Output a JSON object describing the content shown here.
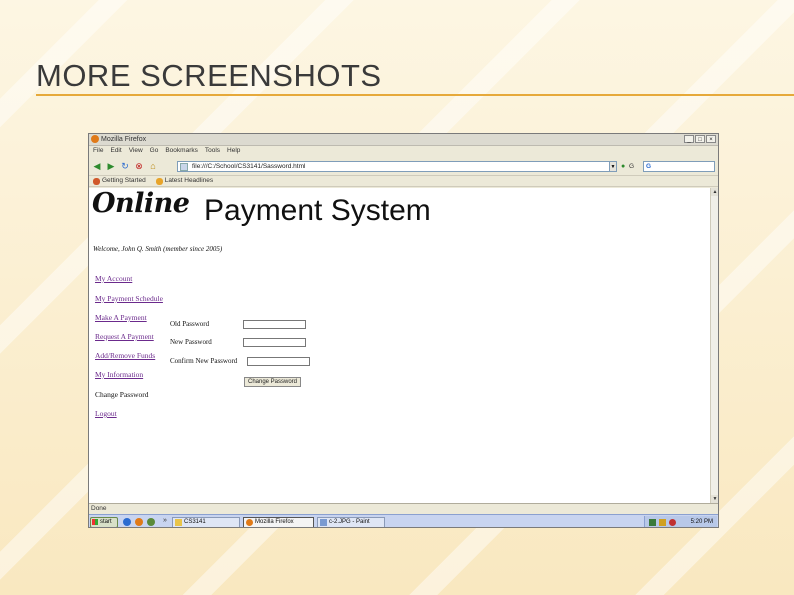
{
  "slide": {
    "title": "MORE SCREENSHOTS"
  },
  "window": {
    "title": "Mozilla Firefox",
    "menu": [
      "File",
      "Edit",
      "View",
      "Go",
      "Bookmarks",
      "Tools",
      "Help"
    ],
    "url": "file:///C:/School/CS3141/Sassword.html",
    "search_prefix": "G",
    "bookmarks": [
      "Getting Started",
      "Latest Headlines"
    ],
    "status": "Done"
  },
  "page": {
    "logo_script": "Online",
    "logo_main": "Payment System",
    "welcome": "Welcome, John Q. Smith (member since 2005)",
    "nav": [
      "My Account",
      "My Payment Schedule",
      "Make A Payment",
      "Request A Payment",
      "Add/Remove Funds",
      "My Information",
      "Change Password",
      "Logout"
    ],
    "form": {
      "old_label": "Old Password",
      "new_label": "New Password",
      "confirm_label": "Confirm New Password",
      "button": "Change Password"
    }
  },
  "taskbar": {
    "start": "start",
    "items": [
      "CS3141",
      "Mozilla Firefox",
      "c-2.JPG - Paint"
    ],
    "clock": "5:20 PM"
  },
  "colors": {
    "title_rule": "#e6a93a",
    "link": "#6b2a8c"
  }
}
